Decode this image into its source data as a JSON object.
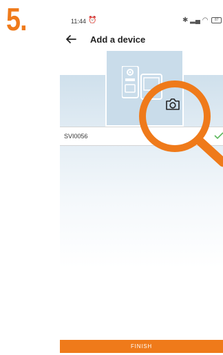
{
  "step": {
    "number": "5."
  },
  "status_bar": {
    "time": "11:44",
    "alarm_icon": "alarm-icon",
    "battery_level": "87"
  },
  "header": {
    "title": "Add a device",
    "back_icon": "arrow-left-icon"
  },
  "device_field": {
    "value": "SVI0056",
    "valid": true
  },
  "finish_button": {
    "label": "FINISH"
  },
  "colors": {
    "accent": "#ef7a1a",
    "band": "#cfe0ec",
    "preview_bg": "#c9dcea",
    "check": "#5cb85c"
  }
}
